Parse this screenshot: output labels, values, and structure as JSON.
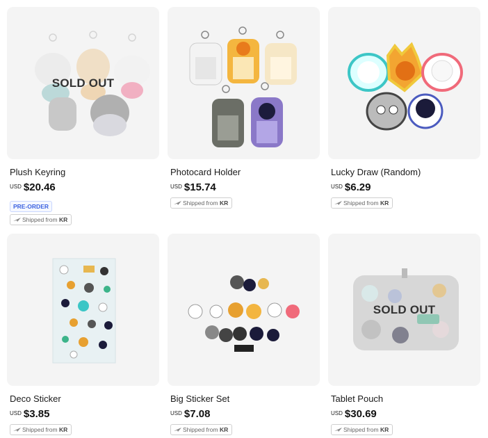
{
  "products": [
    {
      "name": "Plush Keyring",
      "currency": "USD",
      "price": "$20.46",
      "sold_out": "SOLD OUT",
      "badge": "PRE-ORDER",
      "ship_text": "Shipped from",
      "ship_origin": "KR"
    },
    {
      "name": "Photocard Holder",
      "currency": "USD",
      "price": "$15.74",
      "ship_text": "Shipped from",
      "ship_origin": "KR"
    },
    {
      "name": "Lucky Draw (Random)",
      "currency": "USD",
      "price": "$6.29",
      "ship_text": "Shipped from",
      "ship_origin": "KR"
    },
    {
      "name": "Deco Sticker",
      "currency": "USD",
      "price": "$3.85",
      "ship_text": "Shipped from",
      "ship_origin": "KR"
    },
    {
      "name": "Big Sticker Set",
      "currency": "USD",
      "price": "$7.08",
      "ship_text": "Shipped from",
      "ship_origin": "KR"
    },
    {
      "name": "Tablet Pouch",
      "currency": "USD",
      "price": "$30.69",
      "sold_out": "SOLD OUT",
      "ship_text": "Shipped from",
      "ship_origin": "KR"
    }
  ],
  "colors": {
    "accent_preorder": "#3d63e0",
    "thumb_bg": "#f4f4f4"
  },
  "icons": {
    "ship": "airplane-icon"
  }
}
